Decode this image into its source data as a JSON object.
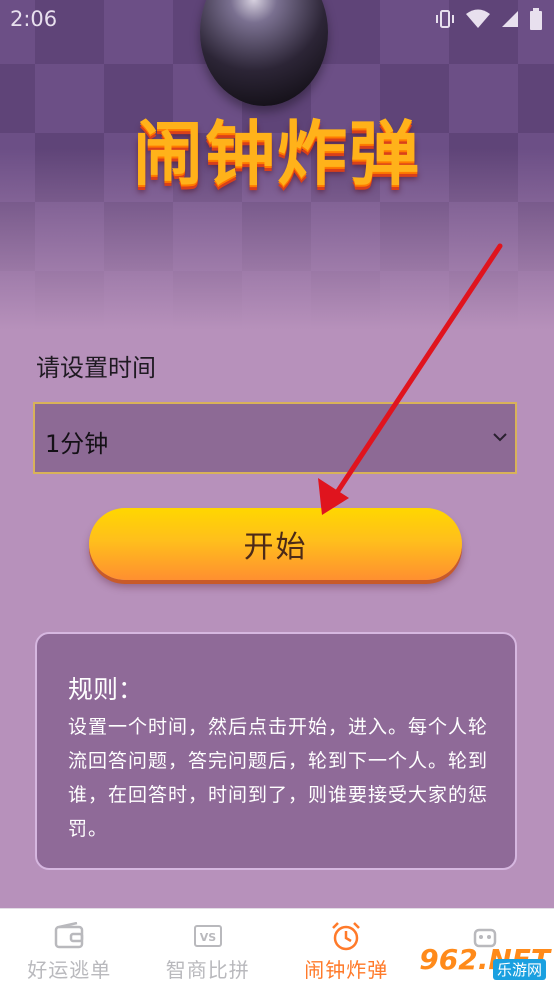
{
  "status_bar": {
    "time": "2:06"
  },
  "header": {
    "title": "闹钟炸弹"
  },
  "timer": {
    "label": "请设置时间",
    "selected": "1分钟"
  },
  "start_button": {
    "label": "开始"
  },
  "rules": {
    "title": "规则：",
    "body": "设置一个时间，然后点击开始，进入。每个人轮流回答问题，答完问题后，轮到下一个人。轮到谁，在回答时，时间到了，则谁要接受大家的惩罚。"
  },
  "nav": {
    "items": [
      {
        "label": "好运逃单",
        "icon": "wallet-icon",
        "active": false
      },
      {
        "label": "智商比拼",
        "icon": "vs-icon",
        "active": false
      },
      {
        "label": "闹钟炸弹",
        "icon": "alarm-clock-icon",
        "active": true
      },
      {
        "label": "",
        "icon": "robot-icon",
        "active": false
      }
    ]
  },
  "watermark": {
    "logo": "962.NET",
    "sub": "乐游网"
  },
  "colors": {
    "accent": "#ff7a2a",
    "background": "#b791bb",
    "arrow": "#e0141e"
  }
}
